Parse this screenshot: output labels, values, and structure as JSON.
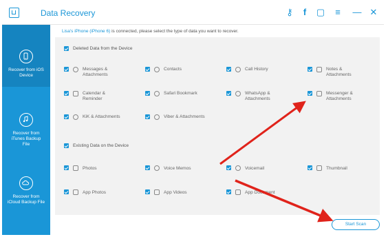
{
  "window": {
    "title": "Data Recovery",
    "toolbar_icons": [
      "key-icon",
      "facebook-icon",
      "feedback-icon",
      "menu-icon",
      "minimize-icon",
      "close-icon"
    ],
    "toolbar_glyphs": [
      "⚷",
      "f",
      "▢",
      "≡",
      "—",
      "✕"
    ]
  },
  "sidebar": {
    "items": [
      {
        "label": "Recover from iOS Device",
        "active": true
      },
      {
        "label": "Recover from iTunes Backup File",
        "active": false
      },
      {
        "label": "Recover from iCloud Backup File",
        "active": false
      }
    ]
  },
  "notice": {
    "device": "Lisa's iPhone (iPhone 6)",
    "text": " is connected, please select the type of data you want to recover."
  },
  "sections": {
    "deleted": {
      "label": "Deleted Data from the Device",
      "items": [
        {
          "label": "Messages & Attachments",
          "icon": "message-icon"
        },
        {
          "label": "Contacts",
          "icon": "contacts-icon"
        },
        {
          "label": "Call History",
          "icon": "call-history-icon"
        },
        {
          "label": "Notes & Attachments",
          "icon": "notes-icon"
        },
        {
          "label": "Calendar & Reminder",
          "icon": "calendar-icon"
        },
        {
          "label": "Safari Bookmark",
          "icon": "safari-icon"
        },
        {
          "label": "WhatsApp & Attachments",
          "icon": "whatsapp-icon"
        },
        {
          "label": "Messenger & Attachments",
          "icon": "messenger-icon"
        },
        {
          "label": "KiK & Attachments",
          "icon": "kik-icon"
        },
        {
          "label": "Viber & Attachments",
          "icon": "viber-icon"
        }
      ]
    },
    "existing": {
      "label": "Existing Data on the Device",
      "items": [
        {
          "label": "Photos",
          "icon": "camera-icon"
        },
        {
          "label": "Voice Memos",
          "icon": "voice-memo-icon"
        },
        {
          "label": "Voicemail",
          "icon": "voicemail-icon"
        },
        {
          "label": "Thumbnail",
          "icon": "thumbnail-icon"
        },
        {
          "label": "App Photos",
          "icon": "app-photos-icon"
        },
        {
          "label": "App Videos",
          "icon": "app-videos-icon"
        },
        {
          "label": "App Document",
          "icon": "app-document-icon"
        }
      ]
    }
  },
  "actions": {
    "start_scan": "Start Scan"
  },
  "colors": {
    "accent": "#1a96d7",
    "annotation_arrow": "#e0231b"
  }
}
